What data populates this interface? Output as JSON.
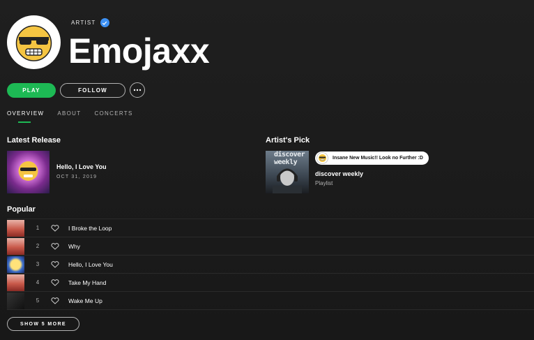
{
  "header": {
    "artist_label": "ARTIST",
    "artist_name": "Emojaxx"
  },
  "actions": {
    "play_label": "PLAY",
    "follow_label": "FOLLOW"
  },
  "tabs": [
    {
      "label": "OVERVIEW",
      "active": true
    },
    {
      "label": "ABOUT",
      "active": false
    },
    {
      "label": "CONCERTS",
      "active": false
    }
  ],
  "latest_release": {
    "section_title": "Latest Release",
    "title": "Hello, I Love You",
    "date": "OCT 31, 2019"
  },
  "artists_pick": {
    "section_title": "Artist's Pick",
    "cover_text": "discover weekly",
    "comment": "Insane New Music!! Look no Further :D",
    "title": "discover weekly",
    "subtitle": "Playlist"
  },
  "popular": {
    "section_title": "Popular",
    "tracks": [
      {
        "num": "1",
        "title": "I Broke the Loop",
        "thumb": "red"
      },
      {
        "num": "2",
        "title": "Why",
        "thumb": "red"
      },
      {
        "num": "3",
        "title": "Hello, I Love You",
        "thumb": "emoji"
      },
      {
        "num": "4",
        "title": "Take My Hand",
        "thumb": "red"
      },
      {
        "num": "5",
        "title": "Wake Me Up",
        "thumb": "dark"
      }
    ],
    "show_more_label": "SHOW 5 MORE"
  },
  "colors": {
    "accent": "#1db954",
    "verified": "#3d91f4",
    "background": "#1b1b1b"
  }
}
